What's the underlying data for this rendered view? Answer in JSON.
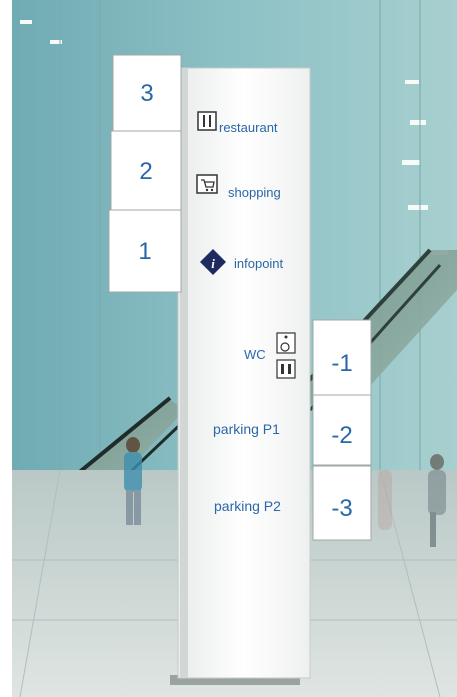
{
  "directory_left": [
    {
      "floor": "3"
    },
    {
      "floor": "2"
    },
    {
      "floor": "1"
    }
  ],
  "directory_right": [
    {
      "floor": "-1"
    },
    {
      "floor": "-2"
    },
    {
      "floor": "-3"
    }
  ],
  "destinations": {
    "restaurant": "restaurant",
    "shopping": "shopping",
    "infopoint": "infopoint",
    "wc": "WC",
    "parking_p1": "parking P1",
    "parking_p2": "parking P2"
  },
  "icons": [
    "cutlery-icon",
    "shopping-cart-icon",
    "info-icon",
    "wheelchair-icon",
    "restroom-icon"
  ],
  "colors": {
    "sign_text": "#2a67a8",
    "wall": "#7fb3ba",
    "floor": "#c9d3d1"
  }
}
